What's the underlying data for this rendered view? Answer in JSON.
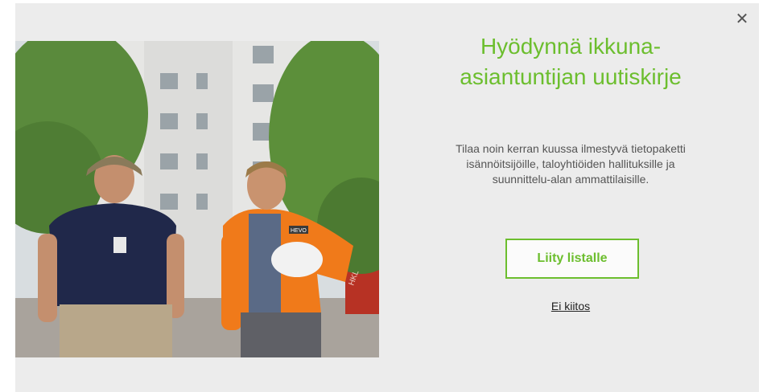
{
  "modal": {
    "close_icon": "close-icon",
    "close_glyph": "✕",
    "title_line1": "Hyödynnä ikkuna-",
    "title_line2": "asiantuntijan uutiskirje",
    "description_line1": "Tilaa noin kerran kuussa ilmestyvä tietopaketti",
    "description_line2": "isännöitsijöille, taloyhtiöiden hallituksille ja",
    "description_line3": "suunnittelu-alan ammattilaisille.",
    "join_button": "Liity listalle",
    "decline_link": "Ei kiitos",
    "accent_color": "#6cbe2e",
    "background_color": "#ececec"
  },
  "photo": {
    "badge_text": "HKL",
    "vest_text": "HEVO"
  }
}
